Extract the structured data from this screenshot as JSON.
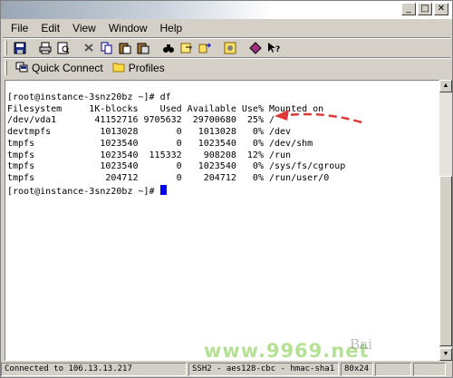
{
  "window": {
    "title": "",
    "buttons": {
      "minimize": "_",
      "maximize": "□",
      "close": "✕"
    }
  },
  "menu": {
    "items": [
      {
        "label": "File"
      },
      {
        "label": "Edit"
      },
      {
        "label": "View"
      },
      {
        "label": "Window"
      },
      {
        "label": "Help"
      }
    ]
  },
  "toolbar": {
    "icons": [
      "save-icon",
      "print-icon",
      "print-preview-icon",
      "cut-icon",
      "copy-icon",
      "paste-icon",
      "paste-special-icon",
      "find-icon",
      "keygen-icon",
      "file-transfer-icon",
      "settings-icon",
      "profiles-icon",
      "help-icon"
    ]
  },
  "quickbar": {
    "quick_connect": "Quick Connect",
    "profiles": "Profiles"
  },
  "terminal": {
    "lines": [
      "[root@instance-3snz20bz ~]# df",
      "Filesystem     1K-blocks    Used Available Use% Mounted on",
      "/dev/vda1       41152716 9705632  29700680  25% /",
      "devtmpfs         1013028       0   1013028   0% /dev",
      "tmpfs            1023540       0   1023540   0% /dev/shm",
      "tmpfs            1023540  115332    908208  12% /run",
      "tmpfs            1023540       0   1023540   0% /sys/fs/cgroup",
      "tmpfs             204712       0    204712   0% /run/user/0"
    ],
    "prompt": "[root@instance-3snz20bz ~]# "
  },
  "status": {
    "connection": "Connected to 106.13.13.217",
    "cipher": "SSH2 - aes128-cbc - hmac-sha1",
    "size": "80x24"
  },
  "watermark": {
    "text": "www.9969.net",
    "site": "Bai"
  },
  "colors": {
    "arrow": "#e03838",
    "cursor": "#0000ff"
  }
}
